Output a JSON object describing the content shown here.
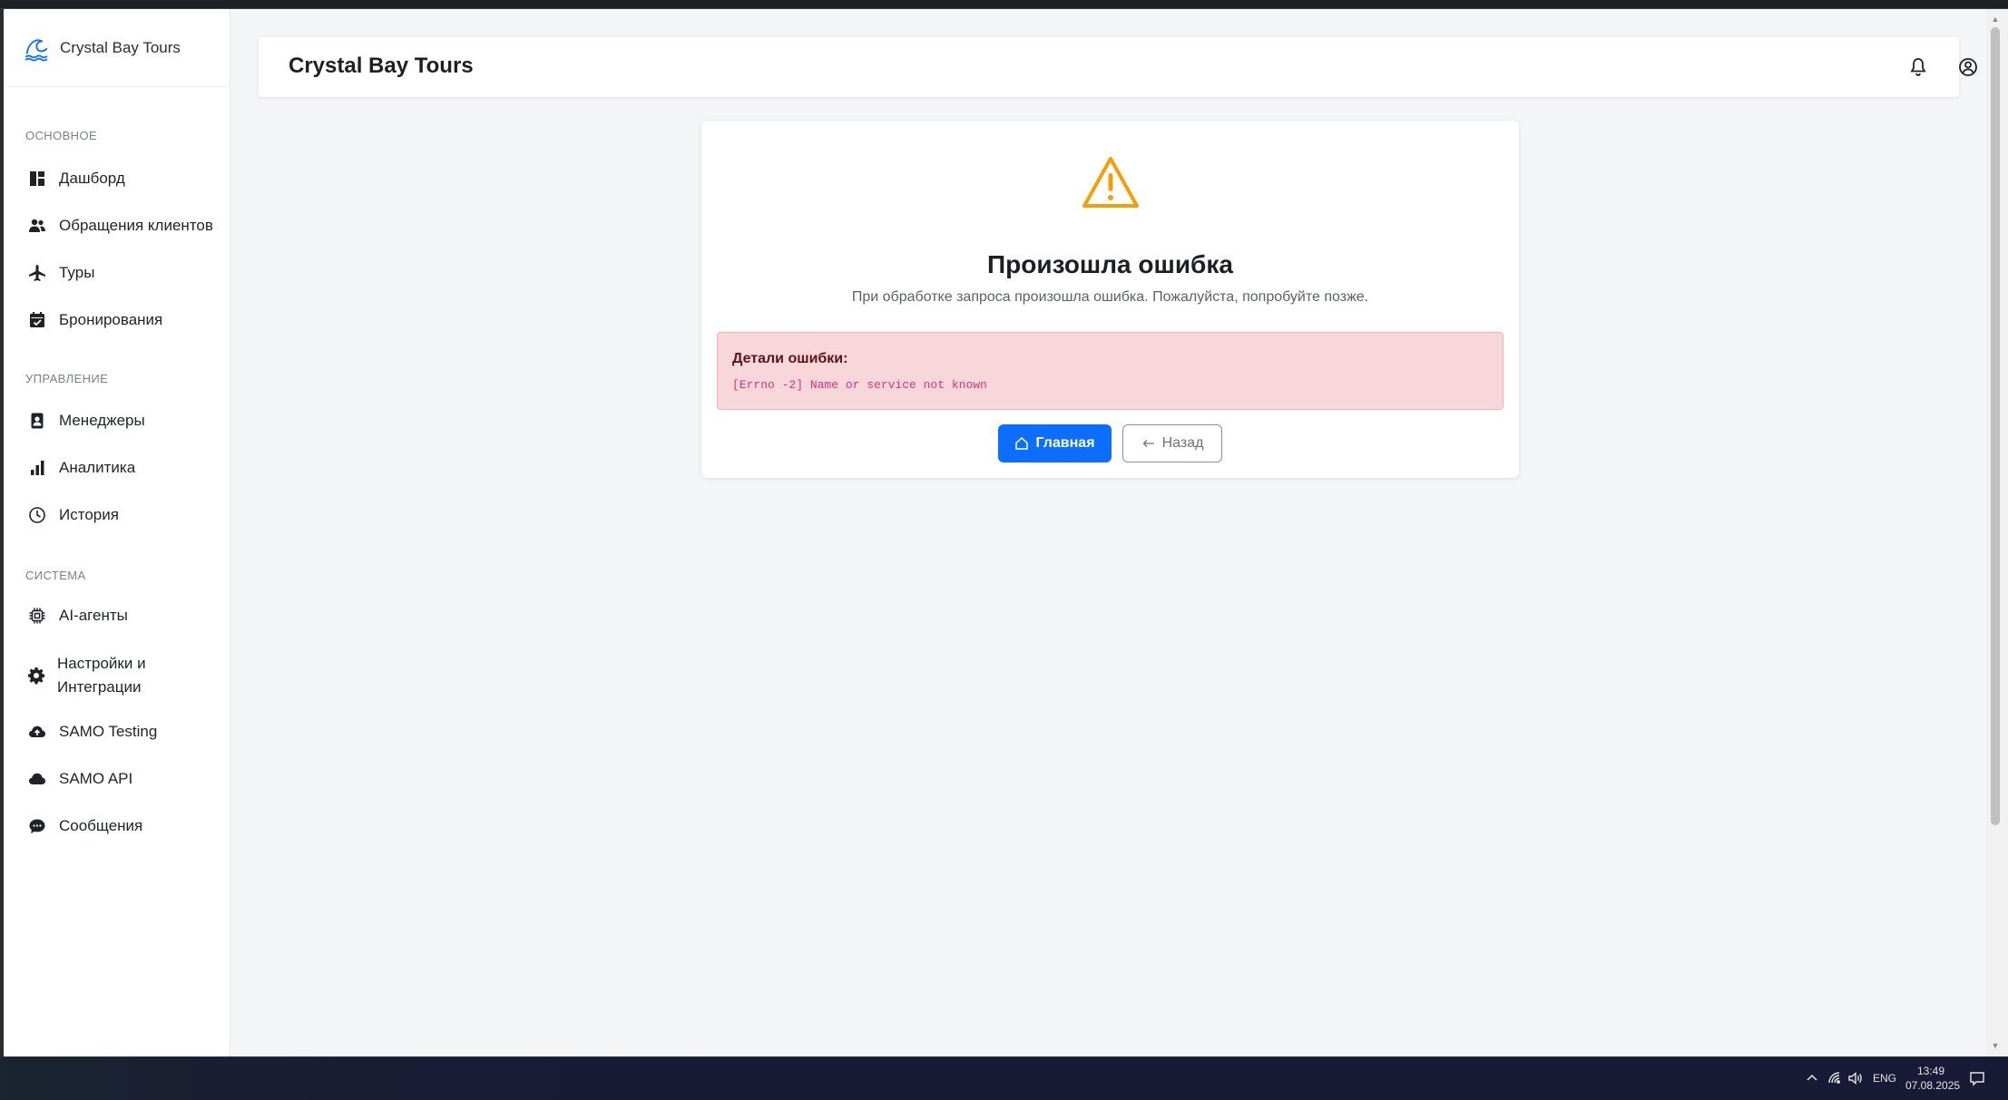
{
  "app": {
    "brand_name": "Crystal Bay Tours"
  },
  "sidebar": {
    "sections": {
      "main": "ОСНОВНОЕ",
      "management": "УПРАВЛЕНИЕ",
      "system": "СИСТЕМА"
    },
    "items": [
      {
        "label": "Дашборд",
        "icon": "dashboard-icon"
      },
      {
        "label": "Обращения клиентов",
        "icon": "people-icon"
      },
      {
        "label": "Туры",
        "icon": "airplane-icon"
      },
      {
        "label": "Бронирования",
        "icon": "calendar-check-icon"
      },
      {
        "label": "Менеджеры",
        "icon": "badge-icon"
      },
      {
        "label": "Аналитика",
        "icon": "bar-chart-icon"
      },
      {
        "label": "История",
        "icon": "clock-icon"
      },
      {
        "label": "AI-агенты",
        "icon": "cpu-icon"
      },
      {
        "label": "Настройки и Интеграции",
        "icon": "gear-icon"
      },
      {
        "label": "SAMO Testing",
        "icon": "cloud-upload-icon"
      },
      {
        "label": "SAMO API",
        "icon": "cloud-icon"
      },
      {
        "label": "Сообщения",
        "icon": "chat-icon"
      }
    ]
  },
  "header": {
    "title": "Crystal Bay Tours",
    "icons": [
      "bell-icon",
      "user-circle-icon"
    ]
  },
  "error": {
    "icon": "warning-triangle-icon",
    "title": "Произошла ошибка",
    "subtitle": "При обработке запроса произошла ошибка. Пожалуйста, попробуйте позже.",
    "details_title": "Детали ошибки:",
    "details_code": "[Errno -2] Name or service not known",
    "home_button": "Главная",
    "back_button": "Назад"
  },
  "taskbar": {
    "language": "ENG",
    "time": "13:49",
    "date": "07.08.2025"
  },
  "colors": {
    "primary": "#0d6efd",
    "warning": "#f59e0b",
    "alert_bg": "#f8d7da",
    "code_text": "#d63384"
  }
}
